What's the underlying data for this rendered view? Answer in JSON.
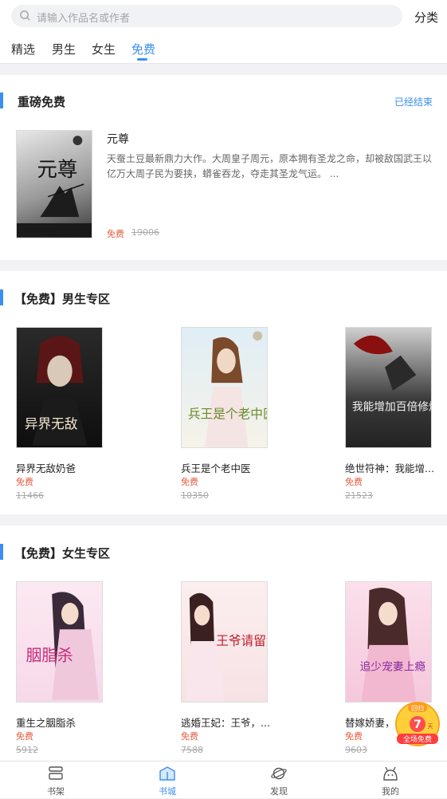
{
  "search": {
    "placeholder": "请输入作品名或作者"
  },
  "header": {
    "category_label": "分类"
  },
  "tabs": [
    {
      "label": "精选"
    },
    {
      "label": "男生"
    },
    {
      "label": "女生"
    },
    {
      "label": "免费",
      "active": true
    }
  ],
  "featured": {
    "section_title": "重磅免费",
    "status_link": "已经结束",
    "book": {
      "title": "元尊",
      "description": "天蚕土豆最新鼎力大作。大周皇子周元，原本拥有圣龙之命，却被敌国武王以亿万大周子民为要挟，蟒雀吞龙，夺走其圣龙气运。 ...",
      "cover_text": "元尊",
      "price_label": "免费",
      "original_price": "19006"
    }
  },
  "male_zone": {
    "section_title": "【免费】男生专区",
    "books": [
      {
        "title": "异界无敌奶爸",
        "price_label": "免费",
        "original_price": "11466",
        "cover_text": "异界无敌"
      },
      {
        "title": "兵王是个老中医",
        "price_label": "免费",
        "original_price": "10350",
        "cover_text": "兵王是个老中医"
      },
      {
        "title": "绝世符神：我能增...",
        "price_label": "免费",
        "original_price": "21523",
        "cover_text": "我能增加百倍修炼"
      }
    ]
  },
  "female_zone": {
    "section_title": "【免费】女生专区",
    "books": [
      {
        "title": "重生之胭脂杀",
        "price_label": "免费",
        "original_price": "5912",
        "cover_text": "胭脂杀"
      },
      {
        "title": "逃婚王妃：王爷，...",
        "price_label": "免费",
        "original_price": "7588",
        "cover_text": "王爷请留步"
      },
      {
        "title": "替嫁娇妻，...",
        "price_label": "免费",
        "original_price": "9603",
        "cover_text": "追少宠妻上瘾"
      }
    ]
  },
  "promo_badge": {
    "days": "7",
    "unit": "天",
    "label": "全场免费",
    "top": "回归"
  },
  "bottom_nav": [
    {
      "label": "书架",
      "icon": "bookshelf-icon"
    },
    {
      "label": "书城",
      "icon": "bookstore-icon",
      "active": true
    },
    {
      "label": "发现",
      "icon": "planet-icon"
    },
    {
      "label": "我的",
      "icon": "profile-icon"
    }
  ],
  "colors": {
    "accent": "#3b8ff0",
    "price": "#e85c3d",
    "background": "#f2f2f4"
  }
}
